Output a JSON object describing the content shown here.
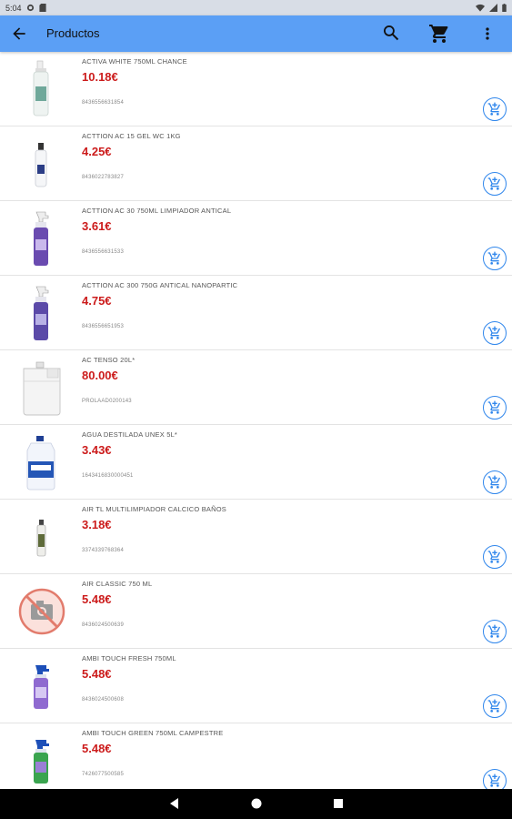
{
  "status": {
    "time": "5:04"
  },
  "app_bar": {
    "title": "Productos"
  },
  "products": [
    {
      "name": "ACTIVA WHITE 750ML CHANCE",
      "price": "10.18€",
      "code": "8436556631854",
      "image": "white-spray-bottle"
    },
    {
      "name": "ACTTION AC 15 GEL WC 1KG",
      "price": "4.25€",
      "code": "8436022783827",
      "image": "white-gel-bottle"
    },
    {
      "name": "ACTTION AC 30 750ML LIMPIADOR ANTICAL",
      "price": "3.61€",
      "code": "8436556631533",
      "image": "purple-spray-bottle"
    },
    {
      "name": "ACTTION AC 300 750G ANTICAL NANOPARTIC",
      "price": "4.75€",
      "code": "8436556651953",
      "image": "purple-spray-bottle"
    },
    {
      "name": "AC TENSO 20L*",
      "price": "80.00€",
      "code": "PROLAAD0200143",
      "image": "white-jerrycan"
    },
    {
      "name": "AGUA DESTILADA UNEX 5L*",
      "price": "3.43€",
      "code": "1643416830000451",
      "image": "water-jug"
    },
    {
      "name": "AIR TL MULTILIMPIADOR CALCICO BAÑOS",
      "price": "3.18€",
      "code": "3374339768364",
      "image": "small-bottle"
    },
    {
      "name": "AIR CLASSIC 750 ML",
      "price": "5.48€",
      "code": "8436024500639",
      "image": "no-image"
    },
    {
      "name": "AMBI TOUCH FRESH 750ML",
      "price": "5.48€",
      "code": "8436024500608",
      "image": "blue-spray-bottle"
    },
    {
      "name": "AMBI TOUCH GREEN 750ML CAMPESTRE",
      "price": "5.48€",
      "code": "7426077500585",
      "image": "green-spray-bottle"
    }
  ]
}
